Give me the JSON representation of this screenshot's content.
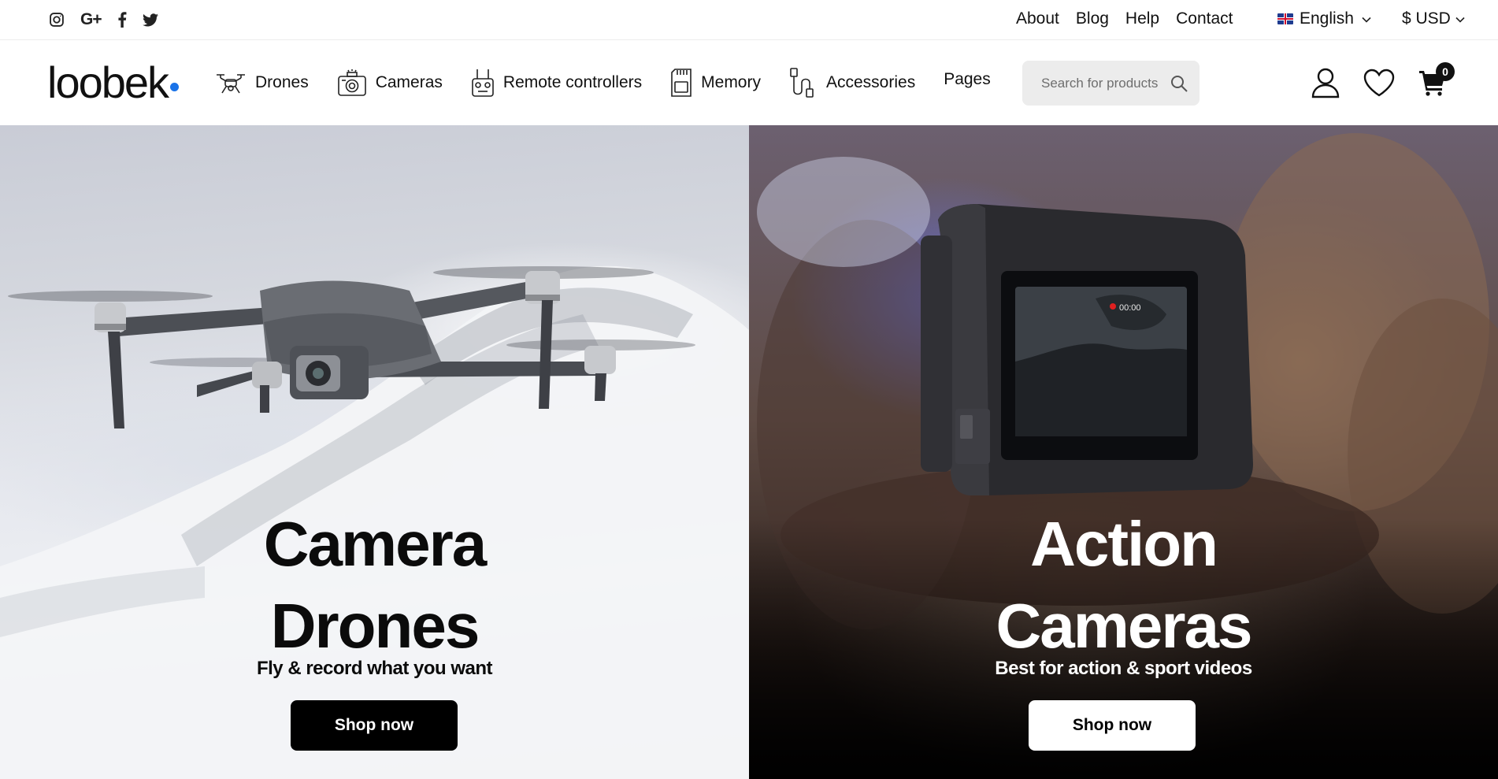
{
  "topbar": {
    "social": [
      {
        "name": "instagram",
        "icon": "instagram-icon"
      },
      {
        "name": "google-plus",
        "icon": "google-plus-icon",
        "text": "G+"
      },
      {
        "name": "facebook",
        "icon": "facebook-icon"
      },
      {
        "name": "twitter",
        "icon": "twitter-icon"
      }
    ],
    "links": [
      "About",
      "Blog",
      "Help",
      "Contact"
    ],
    "language": {
      "label": "English",
      "flag": "uk-flag-icon"
    },
    "currency": {
      "label": "$ USD"
    }
  },
  "nav": {
    "logo": "loobek",
    "logo_dot_color": "#1a73e8",
    "menu": [
      {
        "label": "Drones",
        "icon": "drone-icon"
      },
      {
        "label": "Cameras",
        "icon": "camera-icon"
      },
      {
        "label": "Remote controllers",
        "icon": "remote-controller-icon"
      },
      {
        "label": "Memory",
        "icon": "memory-card-icon"
      },
      {
        "label": "Accessories",
        "icon": "cable-icon"
      },
      {
        "label": "Pages"
      }
    ],
    "search": {
      "placeholder": "Search for products"
    },
    "cart_count": "0"
  },
  "hero": {
    "left": {
      "title_line1": "Camera",
      "title_line2": "Drones",
      "subtitle": "Fly & record what you want",
      "button": "Shop now"
    },
    "right": {
      "title_line1": "Action",
      "title_line2": "Cameras",
      "subtitle": "Best for action & sport videos",
      "button": "Shop now",
      "screen_readout": "00:00"
    }
  }
}
